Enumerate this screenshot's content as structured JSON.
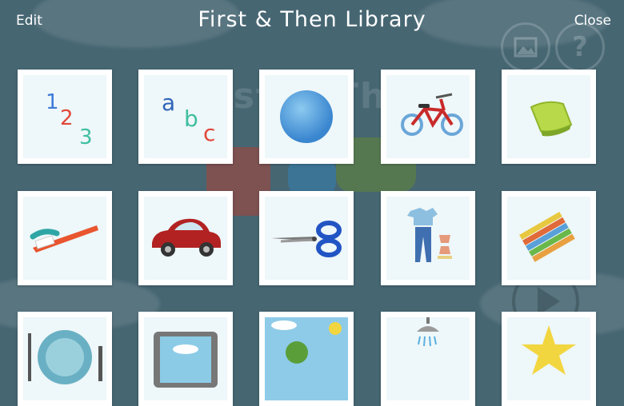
{
  "header": {
    "edit_label": "Edit",
    "title": "First & Then Library",
    "close_label": "Close"
  },
  "background": {
    "ghost_text": "rst & Th",
    "colors": {
      "base": "#466672",
      "puzzle_red": "#c0392b",
      "puzzle_blue": "#2e86c1",
      "puzzle_green": "#6a8f2a"
    }
  },
  "library": {
    "rows": [
      [
        {
          "name": "numbers-123",
          "glyphs": [
            "1",
            "2",
            "3"
          ]
        },
        {
          "name": "letters-abc",
          "glyphs": [
            "a",
            "b",
            "c"
          ]
        },
        {
          "name": "blue-ball"
        },
        {
          "name": "bicycle"
        },
        {
          "name": "sponge"
        }
      ],
      [
        {
          "name": "toothbrush"
        },
        {
          "name": "car"
        },
        {
          "name": "scissors"
        },
        {
          "name": "clothes"
        },
        {
          "name": "crayons"
        }
      ],
      [
        {
          "name": "plate-and-utensils"
        },
        {
          "name": "tablet"
        },
        {
          "name": "outdoor-scene"
        },
        {
          "name": "shower"
        },
        {
          "name": "star"
        }
      ]
    ]
  }
}
